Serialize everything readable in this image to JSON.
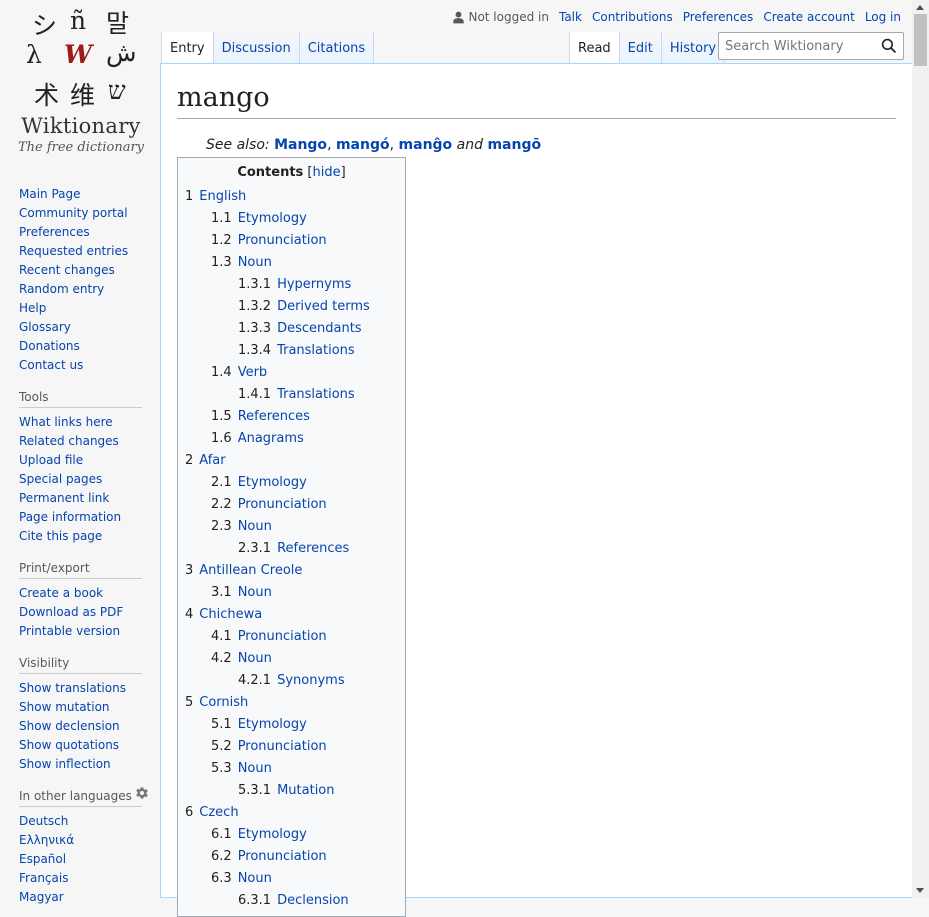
{
  "logo": {
    "glyphs": [
      "シ",
      "ñ",
      "말",
      "λ",
      "W",
      "ش",
      "术",
      "维",
      "ש"
    ],
    "wordmark": "Wiktionary",
    "tagline": "The free dictionary"
  },
  "personal": {
    "not_logged_in": "Not logged in",
    "links": [
      "Talk",
      "Contributions",
      "Preferences",
      "Create account",
      "Log in"
    ]
  },
  "tabs_left": [
    {
      "label": "Entry",
      "selected": true
    },
    {
      "label": "Discussion",
      "selected": false
    },
    {
      "label": "Citations",
      "selected": false
    }
  ],
  "tabs_right": [
    {
      "label": "Read",
      "selected": true
    },
    {
      "label": "Edit",
      "selected": false
    },
    {
      "label": "History",
      "selected": false
    }
  ],
  "search": {
    "placeholder": "Search Wiktionary"
  },
  "sidebar": {
    "navigation": [
      "Main Page",
      "Community portal",
      "Preferences",
      "Requested entries",
      "Recent changes",
      "Random entry",
      "Help",
      "Glossary",
      "Donations",
      "Contact us"
    ],
    "tools": {
      "title": "Tools",
      "items": [
        "What links here",
        "Related changes",
        "Upload file",
        "Special pages",
        "Permanent link",
        "Page information",
        "Cite this page"
      ]
    },
    "print": {
      "title": "Print/export",
      "items": [
        "Create a book",
        "Download as PDF",
        "Printable version"
      ]
    },
    "visibility": {
      "title": "Visibility",
      "items": [
        "Show translations",
        "Show mutation",
        "Show declension",
        "Show quotations",
        "Show inflection"
      ]
    },
    "languages": {
      "title": "In other languages",
      "items": [
        "Deutsch",
        "Ελληνικά",
        "Español",
        "Français",
        "Magyar"
      ]
    }
  },
  "page": {
    "title": "mango",
    "see_also_label": "See also:",
    "see_also_links": [
      "Mango",
      "mangó",
      "manĝo",
      "mangō"
    ],
    "see_also_and": "and"
  },
  "toc": {
    "title": "Contents",
    "hide": "hide",
    "items": [
      {
        "num": "1",
        "text": "English",
        "level": 1
      },
      {
        "num": "1.1",
        "text": "Etymology",
        "level": 2
      },
      {
        "num": "1.2",
        "text": "Pronunciation",
        "level": 2
      },
      {
        "num": "1.3",
        "text": "Noun",
        "level": 2
      },
      {
        "num": "1.3.1",
        "text": "Hypernyms",
        "level": 3
      },
      {
        "num": "1.3.2",
        "text": "Derived terms",
        "level": 3
      },
      {
        "num": "1.3.3",
        "text": "Descendants",
        "level": 3
      },
      {
        "num": "1.3.4",
        "text": "Translations",
        "level": 3
      },
      {
        "num": "1.4",
        "text": "Verb",
        "level": 2
      },
      {
        "num": "1.4.1",
        "text": "Translations",
        "level": 3
      },
      {
        "num": "1.5",
        "text": "References",
        "level": 2
      },
      {
        "num": "1.6",
        "text": "Anagrams",
        "level": 2
      },
      {
        "num": "2",
        "text": "Afar",
        "level": 1
      },
      {
        "num": "2.1",
        "text": "Etymology",
        "level": 2
      },
      {
        "num": "2.2",
        "text": "Pronunciation",
        "level": 2
      },
      {
        "num": "2.3",
        "text": "Noun",
        "level": 2
      },
      {
        "num": "2.3.1",
        "text": "References",
        "level": 3
      },
      {
        "num": "3",
        "text": "Antillean Creole",
        "level": 1
      },
      {
        "num": "3.1",
        "text": "Noun",
        "level": 2
      },
      {
        "num": "4",
        "text": "Chichewa",
        "level": 1
      },
      {
        "num": "4.1",
        "text": "Pronunciation",
        "level": 2
      },
      {
        "num": "4.2",
        "text": "Noun",
        "level": 2
      },
      {
        "num": "4.2.1",
        "text": "Synonyms",
        "level": 3
      },
      {
        "num": "5",
        "text": "Cornish",
        "level": 1
      },
      {
        "num": "5.1",
        "text": "Etymology",
        "level": 2
      },
      {
        "num": "5.2",
        "text": "Pronunciation",
        "level": 2
      },
      {
        "num": "5.3",
        "text": "Noun",
        "level": 2
      },
      {
        "num": "5.3.1",
        "text": "Mutation",
        "level": 3
      },
      {
        "num": "6",
        "text": "Czech",
        "level": 1
      },
      {
        "num": "6.1",
        "text": "Etymology",
        "level": 2
      },
      {
        "num": "6.2",
        "text": "Pronunciation",
        "level": 2
      },
      {
        "num": "6.3",
        "text": "Noun",
        "level": 2
      },
      {
        "num": "6.3.1",
        "text": "Declension",
        "level": 3
      }
    ]
  },
  "colors": {
    "link": "#0645ad",
    "tab_border": "#a7d7f9",
    "logo_accent": "#9b1b1b"
  }
}
